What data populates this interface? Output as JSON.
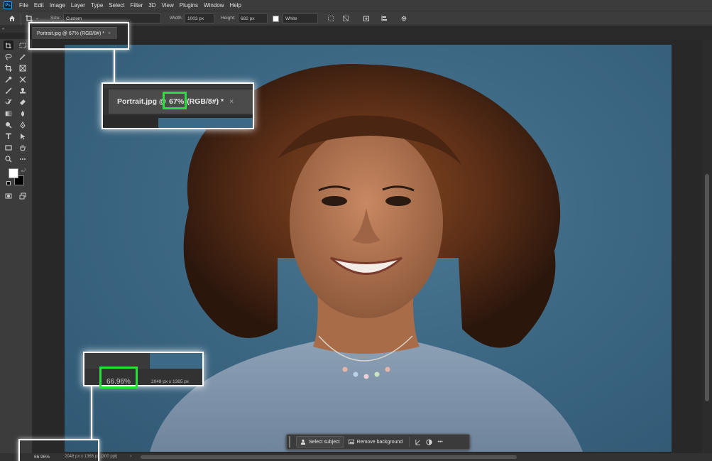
{
  "menubar": {
    "logo": "Ps",
    "items": [
      "File",
      "Edit",
      "Image",
      "Layer",
      "Type",
      "Select",
      "Filter",
      "3D",
      "View",
      "Plugins",
      "Window",
      "Help"
    ]
  },
  "options": {
    "size_label": "Size:",
    "size_value": "Custom",
    "width_label": "Width:",
    "width_value": "1003 px",
    "height_label": "Height:",
    "height_value": "682 px",
    "fill_value": "White"
  },
  "collapse": "«",
  "tab": {
    "title": "Portrait.jpg @ 67% (RGB/8#) *",
    "close": "×"
  },
  "callout_top": {
    "prefix": "Portrait.jpg @",
    "zoom": "67%",
    "suffix": "(RGB/8#) *",
    "close": "×"
  },
  "callout_bottom": {
    "zoom": "66.96%",
    "info": "2048 px x 1365 px"
  },
  "status": {
    "zoom": "66.96%",
    "info": "2048 px x 1365 px (300 ppi)",
    "arrow": "›"
  },
  "taskbar": {
    "select_subject": "Select subject",
    "remove_background": "Remove background",
    "more": "•••"
  },
  "colors": {
    "highlight_green": "#27e03a",
    "callout_border": "#ffffff",
    "backdrop": "#3f6a86"
  }
}
